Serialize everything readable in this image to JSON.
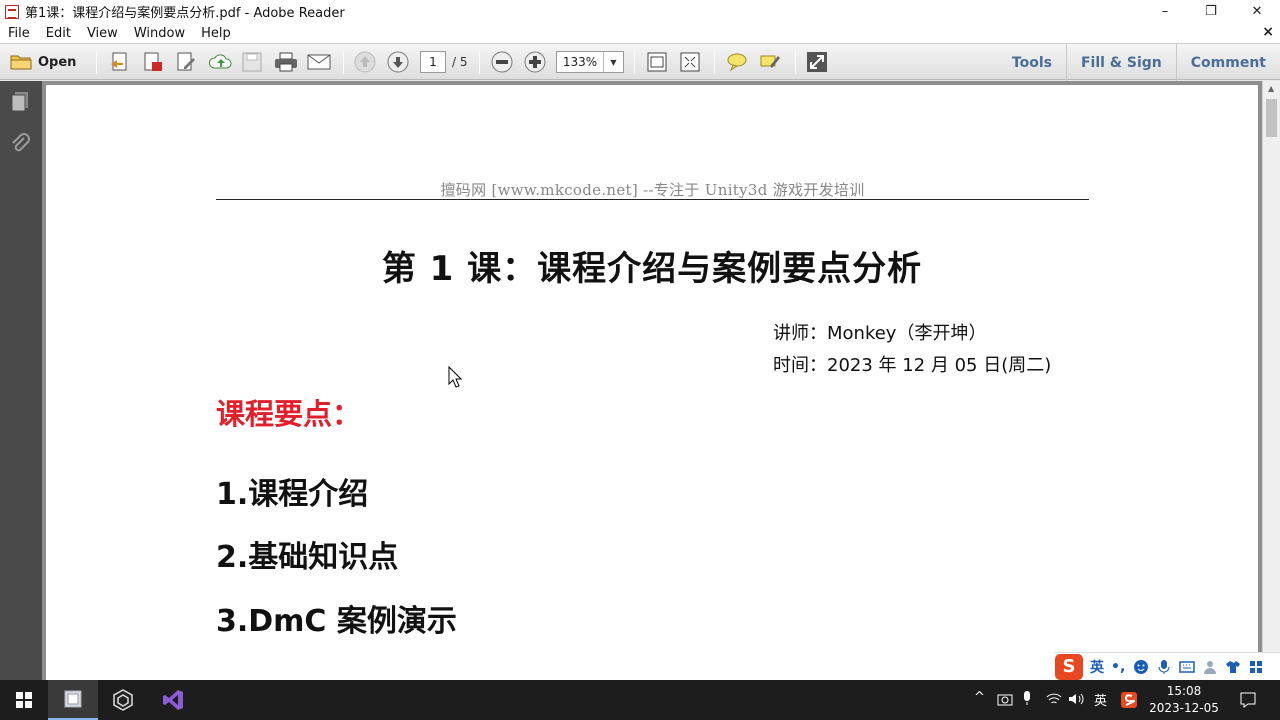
{
  "window": {
    "title": "第1课：课程介绍与案例要点分析.pdf - Adobe Reader",
    "minimize": "–",
    "restore": "❐",
    "close": "✕"
  },
  "menu": {
    "items": [
      "File",
      "Edit",
      "View",
      "Window",
      "Help"
    ],
    "close_doc": "×"
  },
  "toolbar": {
    "open_label": "Open",
    "page_current": "1",
    "page_total": "/ 5",
    "zoom": "133%",
    "tools_label": "Tools",
    "fill_sign_label": "Fill & Sign",
    "comment_label": "Comment"
  },
  "document": {
    "header": "擅码网 [www.mkcode.net] --专注于 Unity3d 游戏开发培训",
    "title": "第 1 课：课程介绍与案例要点分析",
    "lecturer": "讲师：Monkey（李开坤）",
    "date": "时间：2023 年 12 月 05 日(周二)",
    "section_title": "课程要点：",
    "points": [
      "1.课程介绍",
      "2.基础知识点",
      "3.DmC 案例演示"
    ]
  },
  "ime": {
    "logo": "S",
    "lang": "英",
    "punct": "•,"
  },
  "taskbar": {
    "tray_lang": "英",
    "time": "15:08",
    "date": "2023-12-05"
  },
  "colors": {
    "accent_red": "#e0202a",
    "tool_blue": "#4a6e9a",
    "taskbar": "#1d1d1d"
  }
}
